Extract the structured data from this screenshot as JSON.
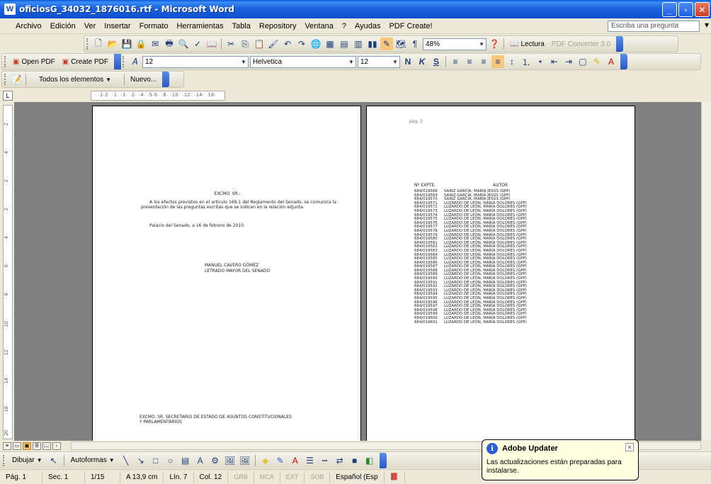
{
  "window": {
    "title": "oficiosG_34032_1876016.rtf - Microsoft Word"
  },
  "menubar": {
    "items": [
      "Archivo",
      "Edición",
      "Ver",
      "Insertar",
      "Formato",
      "Herramientas",
      "Tabla",
      "Repository",
      "Ventana",
      "?",
      "Ayudas",
      "PDF Create!"
    ],
    "help_placeholder": "Escriba una pregunta"
  },
  "toolbar_standard": {
    "zoom": "48%",
    "reading_label": "Lectura",
    "pdf_converter": "PDF Converter 3.0"
  },
  "toolbar_format": {
    "open_pdf": "Open PDF",
    "create_pdf": "Create PDF",
    "style_value": "12",
    "font_value": "Helvetica",
    "size_value": "12",
    "bold": "N",
    "italic": "K",
    "underline": "S"
  },
  "toolbar_third": {
    "all_elements": "Todos los elementos",
    "new_label": "Nuevo..."
  },
  "ruler": {
    "corner": "L",
    "h_text": "· ·1·2·  ·1·  ·1·  ·2·  ·4·  ·5·6·  ·8·  ·10·  ·12·  ·14·  ·16·"
  },
  "page1": {
    "salutation": "EXCMO. SR.:",
    "body": "A los efectos previstos en el artículo 169.1 del Reglamento del Senado, se comunica la presentación de las preguntas escritas que se indican en la relación adjunta.",
    "place_date": "Palacio del Senado, a 16 de febrero de 2010.",
    "signer_name": "MANUEL CAVERO GÓMEZ",
    "signer_title": "LETRADO MAYOR DEL SENADO",
    "recipient_line1": "EXCMO. SR. SECRETARIO DE ESTADO DE ASUNTOS CONSTITUCIONALES",
    "recipient_line2": "Y PARLAMENTARIOS"
  },
  "page2": {
    "page_label": "pág. 2",
    "col_num": "Nº EXPTE.",
    "col_author": "AUTOR",
    "rows": [
      [
        "684/019568",
        "SAINZ GARCÍA, MARÍA JESÚS (GPP)"
      ],
      [
        "684/019569",
        "SAINZ GARCÍA, MARÍA JESÚS (GPP)"
      ],
      [
        "684/019570",
        "SAINZ GARCÍA, MARÍA JESÚS (GPP)"
      ],
      [
        "684/019571",
        "LUZARDO DE LEÓN, MARÍA DOLORES (GPP)"
      ],
      [
        "684/019572",
        "LUZARDO DE LEÓN, MARÍA DOLORES (GPP)"
      ],
      [
        "684/019573",
        "LUZARDO DE LEÓN, MARÍA DOLORES (GPP)"
      ],
      [
        "684/019574",
        "LUZARDO DE LEÓN, MARÍA DOLORES (GPP)"
      ],
      [
        "684/019575",
        "LUZARDO DE LEÓN, MARÍA DOLORES (GPP)"
      ],
      [
        "684/019576",
        "LUZARDO DE LEÓN, MARÍA DOLORES (GPP)"
      ],
      [
        "684/019577",
        "LUZARDO DE LEÓN, MARÍA DOLORES (GPP)"
      ],
      [
        "684/019578",
        "LUZARDO DE LEÓN, MARÍA DOLORES (GPP)"
      ],
      [
        "684/019579",
        "LUZARDO DE LEÓN, MARÍA DOLORES (GPP)"
      ],
      [
        "684/019580",
        "LUZARDO DE LEÓN, MARÍA DOLORES (GPP)"
      ],
      [
        "684/019581",
        "LUZARDO DE LEÓN, MARÍA DOLORES (GPP)"
      ],
      [
        "684/019582",
        "LUZARDO DE LEÓN, MARÍA DOLORES (GPP)"
      ],
      [
        "684/019583",
        "LUZARDO DE LEÓN, MARÍA DOLORES (GPP)"
      ],
      [
        "684/019584",
        "LUZARDO DE LEÓN, MARÍA DOLORES (GPP)"
      ],
      [
        "684/019585",
        "LUZARDO DE LEÓN, MARÍA DOLORES (GPP)"
      ],
      [
        "684/019586",
        "LUZARDO DE LEÓN, MARÍA DOLORES (GPP)"
      ],
      [
        "684/019587",
        "LUZARDO DE LEÓN, MARÍA DOLORES (GPP)"
      ],
      [
        "684/019588",
        "LUZARDO DE LEÓN, MARÍA DOLORES (GPP)"
      ],
      [
        "684/019589",
        "LUZARDO DE LEÓN, MARÍA DOLORES (GPP)"
      ],
      [
        "684/019590",
        "LUZARDO DE LEÓN, MARÍA DOLORES (GPP)"
      ],
      [
        "684/019591",
        "LUZARDO DE LEÓN, MARÍA DOLORES (GPP)"
      ],
      [
        "684/019592",
        "LUZARDO DE LEÓN, MARÍA DOLORES (GPP)"
      ],
      [
        "684/019593",
        "LUZARDO DE LEÓN, MARÍA DOLORES (GPP)"
      ],
      [
        "684/019594",
        "LUZARDO DE LEÓN, MARÍA DOLORES (GPP)"
      ],
      [
        "684/019595",
        "LUZARDO DE LEÓN, MARÍA DOLORES (GPP)"
      ],
      [
        "684/019596",
        "LUZARDO DE LEÓN, MARÍA DOLORES (GPP)"
      ],
      [
        "684/019597",
        "LUZARDO DE LEÓN, MARÍA DOLORES (GPP)"
      ],
      [
        "684/019598",
        "LUZARDO DE LEÓN, MARÍA DOLORES (GPP)"
      ],
      [
        "684/019599",
        "LUZARDO DE LEÓN, MARÍA DOLORES (GPP)"
      ],
      [
        "684/019600",
        "LUZARDO DE LEÓN, MARÍA DOLORES (GPP)"
      ],
      [
        "684/019601",
        "LUZARDO DE LEÓN, MARÍA DOLORES (GPP)"
      ]
    ]
  },
  "drawing_toolbar": {
    "draw_label": "Dibujar",
    "autoshapes_label": "Autoformas"
  },
  "statusbar": {
    "page": "Pág. 1",
    "section": "Sec. 1",
    "page_of": "1/15",
    "at": "A 13,9 cm",
    "line": "Lín. 7",
    "col": "Col. 12",
    "grb": "GRB",
    "mca": "MCA",
    "ext": "EXT",
    "sob": "SOB",
    "language": "Español (Esp"
  },
  "balloon": {
    "title": "Adobe Updater",
    "message": "Las actualizaciones están preparadas para instalarse."
  },
  "colors": {
    "titlebar": "#0d4fd0",
    "chrome": "#ece9d8",
    "doc_bg": "#808080",
    "balloon_bg": "#ffffe1"
  }
}
